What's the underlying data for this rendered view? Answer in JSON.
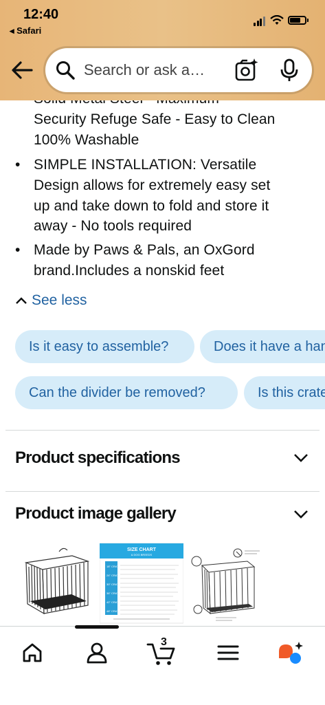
{
  "status": {
    "time": "12:40",
    "back_app": "Safari"
  },
  "search": {
    "placeholder": "Search or ask a…"
  },
  "description": {
    "cut_line": "Solid Metal  Steel  - Maximum",
    "lines_top": [
      "Security Refuge Safe - Easy to Clean",
      "100% Washable"
    ],
    "bullets": [
      [
        "SIMPLE INSTALLATION: Versatile",
        "Design allows for extremely easy set",
        "up and take down to fold and store it",
        "away - No tools required"
      ],
      [
        "Made by Paws & Pals, an OxGord",
        "brand.Includes a nonskid feet"
      ]
    ],
    "see_less": "See less"
  },
  "questions": {
    "row1": [
      "Is it easy to assemble?",
      "Does it have a handle?"
    ],
    "row2": [
      "Can the divider be removed?",
      "Is this crate"
    ]
  },
  "sections": {
    "specs": "Product specifications",
    "gallery": "Product image gallery"
  },
  "gallery_images": [
    "crate-photo",
    "size-chart",
    "crate-diagram"
  ],
  "size_chart": {
    "title": "SIZE CHART",
    "subtitle": "& DOG BREEDS",
    "rows": [
      "18\" CRATE",
      "24\" CRATE",
      "30\" CRATE",
      "36\" CRATE",
      "42\" CRATE",
      "48\" CRATE"
    ]
  },
  "tabbar": {
    "cart_count": "3"
  },
  "colors": {
    "header": "#e7b577",
    "link": "#2162a1",
    "chip_bg": "#d6ecf9",
    "assistant_orange": "#f05a28",
    "assistant_blue": "#1a8cff"
  }
}
